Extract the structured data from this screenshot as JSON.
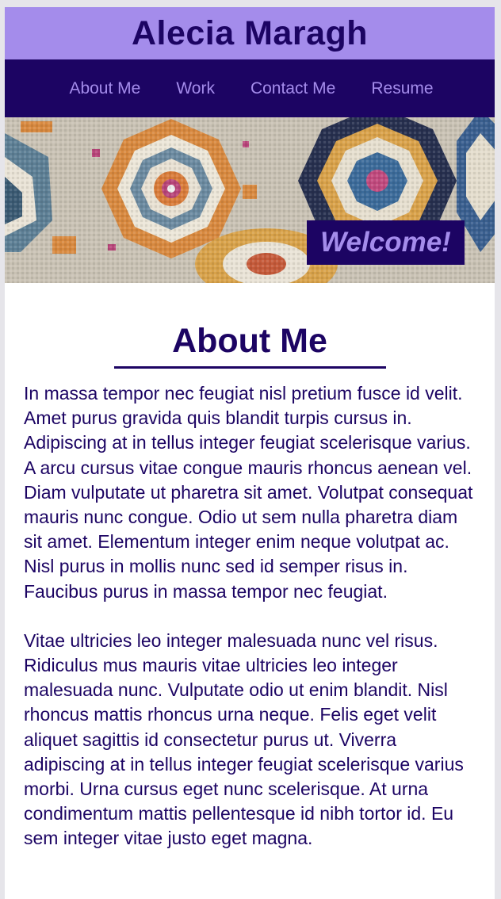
{
  "header": {
    "site_title": "Alecia Maragh"
  },
  "nav": {
    "items": [
      {
        "label": "About Me"
      },
      {
        "label": "Work"
      },
      {
        "label": "Contact Me"
      },
      {
        "label": "Resume"
      }
    ]
  },
  "hero": {
    "welcome_text": "Welcome!",
    "image": "patterned-rug-photo"
  },
  "main": {
    "heading": "About Me",
    "paragraphs": [
      "In massa tempor nec feugiat nisl pretium fusce id velit. Amet purus gravida quis blandit turpis cursus in. Adipiscing at in tellus integer feugiat scelerisque varius. A arcu cursus vitae congue mauris rhoncus aenean vel. Diam vulputate ut pharetra sit amet. Volutpat consequat mauris nunc congue. Odio ut sem nulla pharetra diam sit amet. Elementum integer enim neque volutpat ac. Nisl purus in mollis nunc sed id semper risus in. Faucibus purus in massa tempor nec feugiat.",
      "Vitae ultricies leo integer malesuada nunc vel risus. Ridiculus mus mauris vitae ultricies leo integer malesuada nunc. Vulputate odio ut enim blandit. Nisl rhoncus mattis rhoncus urna neque. Felis eget velit aliquet sagittis id consectetur purus ut. Viverra adipiscing at in tellus integer feugiat scelerisque varius morbi. Urna cursus eget nunc scelerisque. At urna condimentum mattis pellentesque id nibh tortor id. Eu sem integer vitae justo eget magna."
    ]
  },
  "colors": {
    "header_bg": "#a48ceb",
    "nav_bg": "#1c0463",
    "text": "#1c0463",
    "page_bg": "#ffffff"
  }
}
